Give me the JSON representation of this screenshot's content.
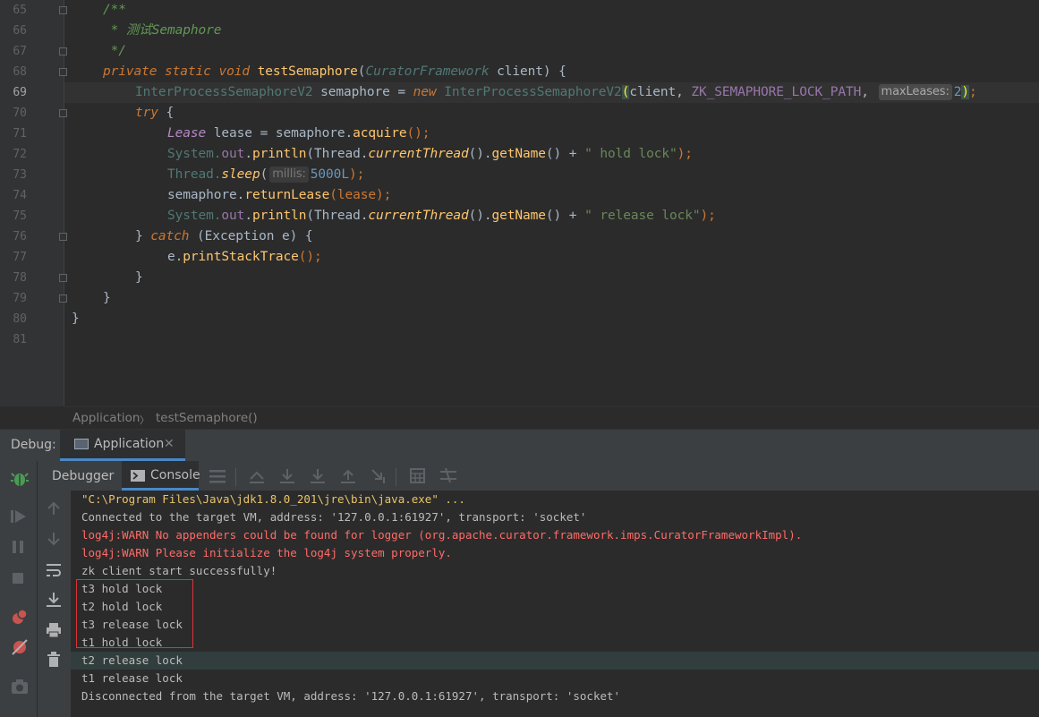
{
  "editor": {
    "lines": [
      {
        "n": "65"
      },
      {
        "n": "66"
      },
      {
        "n": "67"
      },
      {
        "n": "68"
      },
      {
        "n": "69"
      },
      {
        "n": "70"
      },
      {
        "n": "71"
      },
      {
        "n": "72"
      },
      {
        "n": "73"
      },
      {
        "n": "74"
      },
      {
        "n": "75"
      },
      {
        "n": "76"
      },
      {
        "n": "77"
      },
      {
        "n": "78"
      },
      {
        "n": "79"
      },
      {
        "n": "80"
      },
      {
        "n": "81"
      }
    ],
    "code": {
      "l65": "/**",
      "l66_star": " * ",
      "l66_text": "测试Semaphore",
      "l67": " */",
      "l68_mods": "private static void ",
      "l68_name": "testSemaphore",
      "l68_open": "(",
      "l68_type": "CuratorFramework",
      "l68_param": " client) {",
      "l69_type": "InterProcessSemaphoreV2",
      "l69_var": " semaphore = ",
      "l69_new": "new ",
      "l69_ctor": "InterProcessSemaphoreV2",
      "l69_open": "(",
      "l69_args": "client, ",
      "l69_const": "ZK_SEMAPHORE_LOCK_PATH",
      "l69_comma": ", ",
      "l69_hint": "maxLeases:",
      "l69_num": "2",
      "l69_close": ")",
      "l69_semi": ";",
      "l70_try": "try",
      "l70_rest": " {",
      "l71_type": "Lease",
      "l71_var": " lease = semaphore.",
      "l71_call": "acquire",
      "l71_end": "();",
      "l72_sys": "System.",
      "l72_out": "out",
      "l72_dot": ".",
      "l72_println": "println",
      "l72_p1": "(Thread.",
      "l72_ct": "currentThread",
      "l72_p2": "().",
      "l72_gn": "getName",
      "l72_p3": "() + ",
      "l72_str": "\" hold lock\"",
      "l72_end": ");",
      "l73_thread": "Thread.",
      "l73_sleep": "sleep",
      "l73_open": "(",
      "l73_hint": "millis:",
      "l73_num": "5000L",
      "l73_end": ");",
      "l74_obj": "semaphore.",
      "l74_call": "returnLease",
      "l74_end": "(lease);",
      "l75_sys": "System.",
      "l75_out": "out",
      "l75_dot": ".",
      "l75_println": "println",
      "l75_p1": "(Thread.",
      "l75_ct": "currentThread",
      "l75_p2": "().",
      "l75_gn": "getName",
      "l75_p3": "() + ",
      "l75_str": "\" release lock\"",
      "l75_end": ");",
      "l76_close": "} ",
      "l76_catch": "catch",
      "l76_rest": " (Exception e) {",
      "l77_obj": "e.",
      "l77_call": "printStackTrace",
      "l77_end": "();",
      "l78": "}",
      "l79": "}",
      "l80": "}"
    }
  },
  "breadcrumb": {
    "class_name": "Application",
    "separator": "〉",
    "method_name": "testSemaphore()"
  },
  "debug": {
    "label": "Debug:",
    "tab_label": "Application",
    "tab_close": "✕",
    "debugger_tab": "Debugger",
    "console_tab": "Console"
  },
  "console": {
    "lines": [
      "\"C:\\Program Files\\Java\\jdk1.8.0_201\\jre\\bin\\java.exe\" ...",
      "Connected to the target VM, address: '127.0.0.1:61927', transport: 'socket'",
      "log4j:WARN No appenders could be found for logger (org.apache.curator.framework.imps.CuratorFrameworkImpl).",
      "log4j:WARN Please initialize the log4j system properly.",
      "zk client start successfully!",
      "t3 hold lock",
      "t2 hold lock",
      "t3 release lock",
      "t1 hold lock",
      "t2 release lock",
      "t1 release lock",
      "Disconnected from the target VM, address: '127.0.0.1:61927', transport: 'socket'"
    ]
  },
  "colors": {
    "editor_bg": "#2b2b2b",
    "panel_bg": "#3c3f41",
    "highlight_box": "#d9333a",
    "tab_underline": "#4a88c7"
  }
}
